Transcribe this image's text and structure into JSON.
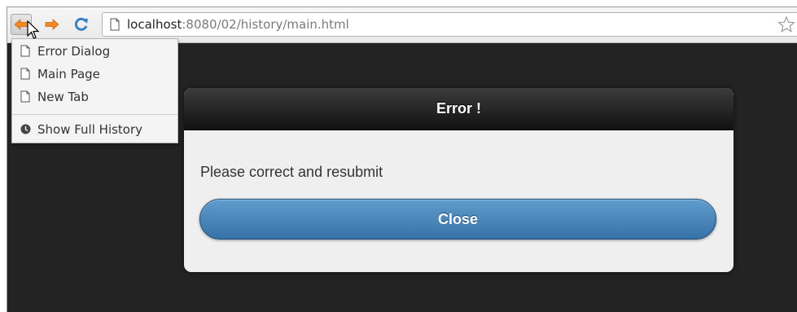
{
  "browser": {
    "url_host": "localhost",
    "url_rest": ":8080/02/history/main.html"
  },
  "history_menu": {
    "items": [
      {
        "label": "Error Dialog",
        "icon": "page-icon"
      },
      {
        "label": "Main Page",
        "icon": "page-icon"
      },
      {
        "label": "New Tab",
        "icon": "page-icon"
      }
    ],
    "show_full_history_label": "Show Full History"
  },
  "dialog": {
    "title": "Error !",
    "message": "Please correct and resubmit",
    "close_label": "Close"
  },
  "colors": {
    "page_background": "#232323",
    "header_background": "#1a1a1a",
    "close_button": "#4a86bb",
    "nav_arrows": "#f08a24",
    "reload_icon": "#3a82c6"
  }
}
